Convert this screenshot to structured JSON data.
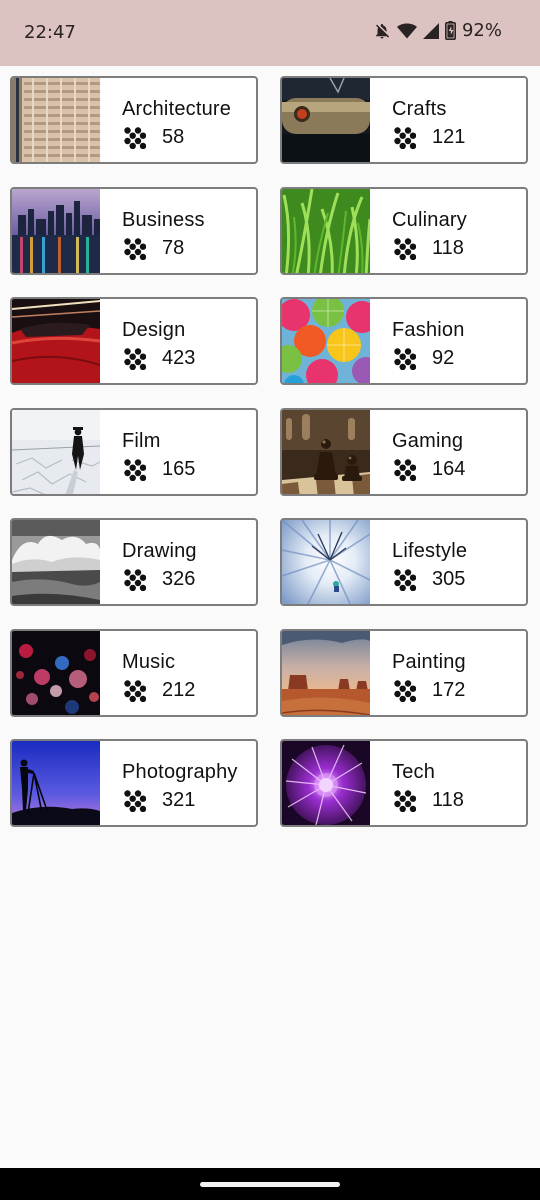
{
  "status_bar": {
    "time": "22:47",
    "battery": "92%",
    "icons": [
      "notifications-off-icon",
      "wifi-icon",
      "cell-signal-icon",
      "battery-icon"
    ]
  },
  "categories": [
    {
      "name": "Architecture",
      "count": "58",
      "thumb_icon": "architecture-photo"
    },
    {
      "name": "Crafts",
      "count": "121",
      "thumb_icon": "crafts-photo"
    },
    {
      "name": "Business",
      "count": "78",
      "thumb_icon": "business-photo"
    },
    {
      "name": "Culinary",
      "count": "118",
      "thumb_icon": "culinary-photo"
    },
    {
      "name": "Design",
      "count": "423",
      "thumb_icon": "design-photo"
    },
    {
      "name": "Fashion",
      "count": "92",
      "thumb_icon": "fashion-photo"
    },
    {
      "name": "Film",
      "count": "165",
      "thumb_icon": "film-photo"
    },
    {
      "name": "Gaming",
      "count": "164",
      "thumb_icon": "gaming-photo"
    },
    {
      "name": "Drawing",
      "count": "326",
      "thumb_icon": "drawing-photo"
    },
    {
      "name": "Lifestyle",
      "count": "305",
      "thumb_icon": "lifestyle-photo"
    },
    {
      "name": "Music",
      "count": "212",
      "thumb_icon": "music-photo"
    },
    {
      "name": "Painting",
      "count": "172",
      "thumb_icon": "painting-photo"
    },
    {
      "name": "Photography",
      "count": "321",
      "thumb_icon": "photography-photo"
    },
    {
      "name": "Tech",
      "count": "118",
      "thumb_icon": "tech-photo"
    }
  ]
}
